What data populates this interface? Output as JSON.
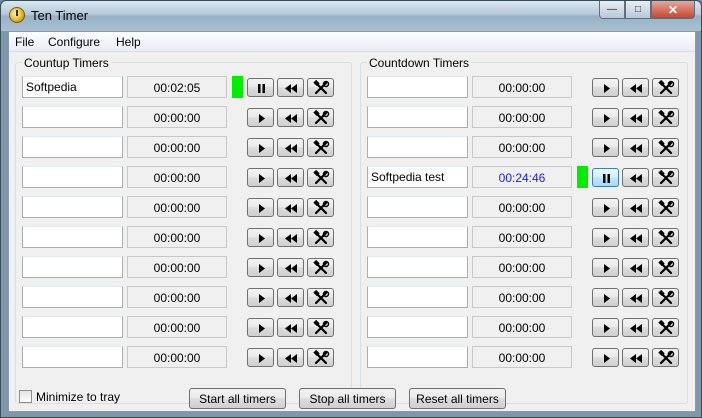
{
  "window": {
    "title": "Ten Timer"
  },
  "menu": [
    "File",
    "Configure",
    "Help"
  ],
  "countup": {
    "label": "Countup Timers",
    "timers": [
      {
        "name": "Softpedia",
        "time": "00:02:05",
        "running": true
      },
      {
        "name": "",
        "time": "00:00:00",
        "running": false
      },
      {
        "name": "",
        "time": "00:00:00",
        "running": false
      },
      {
        "name": "",
        "time": "00:00:00",
        "running": false
      },
      {
        "name": "",
        "time": "00:00:00",
        "running": false
      },
      {
        "name": "",
        "time": "00:00:00",
        "running": false
      },
      {
        "name": "",
        "time": "00:00:00",
        "running": false
      },
      {
        "name": "",
        "time": "00:00:00",
        "running": false
      },
      {
        "name": "",
        "time": "00:00:00",
        "running": false
      },
      {
        "name": "",
        "time": "00:00:00",
        "running": false
      }
    ]
  },
  "countdown": {
    "label": "Countdown Timers",
    "timers": [
      {
        "name": "",
        "time": "00:00:00",
        "running": false
      },
      {
        "name": "",
        "time": "00:00:00",
        "running": false
      },
      {
        "name": "",
        "time": "00:00:00",
        "running": false
      },
      {
        "name": "Softpedia test",
        "time": "00:24:46",
        "running": true,
        "highlight": "#1a1aff",
        "pressed": true
      },
      {
        "name": "",
        "time": "00:00:00",
        "running": false
      },
      {
        "name": "",
        "time": "00:00:00",
        "running": false
      },
      {
        "name": "",
        "time": "00:00:00",
        "running": false
      },
      {
        "name": "",
        "time": "00:00:00",
        "running": false
      },
      {
        "name": "",
        "time": "00:00:00",
        "running": false
      },
      {
        "name": "",
        "time": "00:00:00",
        "running": false
      }
    ]
  },
  "footer": {
    "minimize_label": "Minimize to tray",
    "minimize_checked": false,
    "start_all": "Start all timers",
    "stop_all": "Stop all timers",
    "reset_all": "Reset all timers"
  },
  "icons": {
    "play": "play-icon",
    "pause": "pause-icon",
    "rewind": "rewind-icon",
    "settings": "tools-icon"
  },
  "colors": {
    "running_indicator": "#00ee00",
    "countdown_active_text": "#1a1aff"
  }
}
